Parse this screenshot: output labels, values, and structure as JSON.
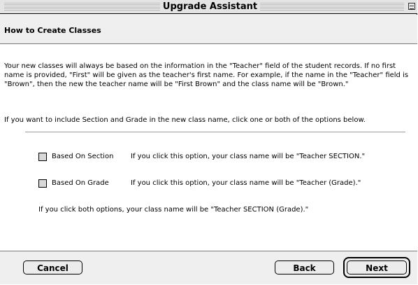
{
  "window": {
    "title": "Upgrade Assistant"
  },
  "header": {
    "title": "How to Create Classes"
  },
  "content": {
    "intro_paragraph": "Your new classes will always be based on the information in the \"Teacher\" field of the student records. If no first name is provided, \"First\" will be given as the teacher's first name.  For example, if the name in the \"Teacher\" field is \"Brown\", then the new the teacher name will be \"First Brown\" and the class name will be \"Brown.\"",
    "options_prompt": "If you want to include Section and Grade in the new class name, click one or both of the options below.",
    "options": [
      {
        "label": "Based On Section",
        "description": "If you click this option, your class name will be \"Teacher SECTION.\"",
        "checked": false
      },
      {
        "label": "Based On Grade",
        "description": "If you click this option, your class name will be \"Teacher (Grade).\"",
        "checked": false
      }
    ],
    "both_note": "If you click both options, your class name will be \"Teacher SECTION (Grade).\""
  },
  "footer": {
    "cancel_label": "Cancel",
    "back_label": "Back",
    "next_label": "Next"
  }
}
